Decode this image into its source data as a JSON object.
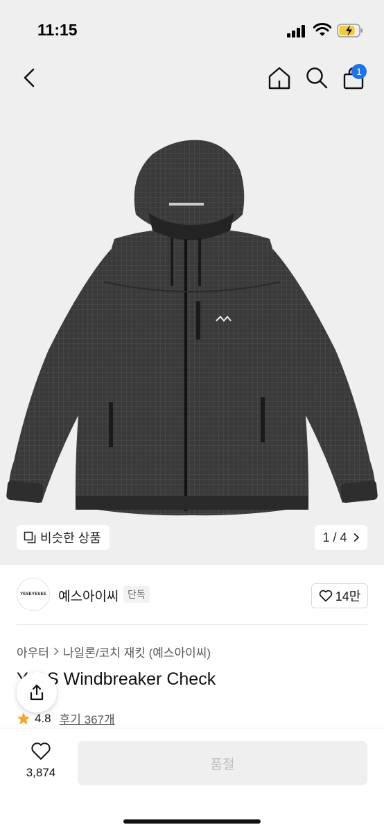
{
  "status": {
    "time": "11:15"
  },
  "nav": {
    "cart_count": "1"
  },
  "gallery": {
    "similar_label": "비슷한 상품",
    "counter": "1 / 4"
  },
  "brand": {
    "logo_text": "YESEYESEE",
    "name": "예스아이씨",
    "tag": "단독",
    "likes": "14만"
  },
  "product": {
    "breadcrumb": [
      "아우터",
      "나일론/코치 재킷 (예스아이씨)"
    ],
    "title_visible": "Windbreaker Check",
    "title_partial": "Y.E.S",
    "rating": "4.8",
    "reviews": "후기 367개"
  },
  "bottom": {
    "wish_count": "3,874",
    "buy_label": "품절"
  },
  "colors": {
    "accent": "#1e73ea",
    "star": "#f5a623",
    "hero_bg": "#efefef",
    "jacket": "#3a3a3a"
  }
}
